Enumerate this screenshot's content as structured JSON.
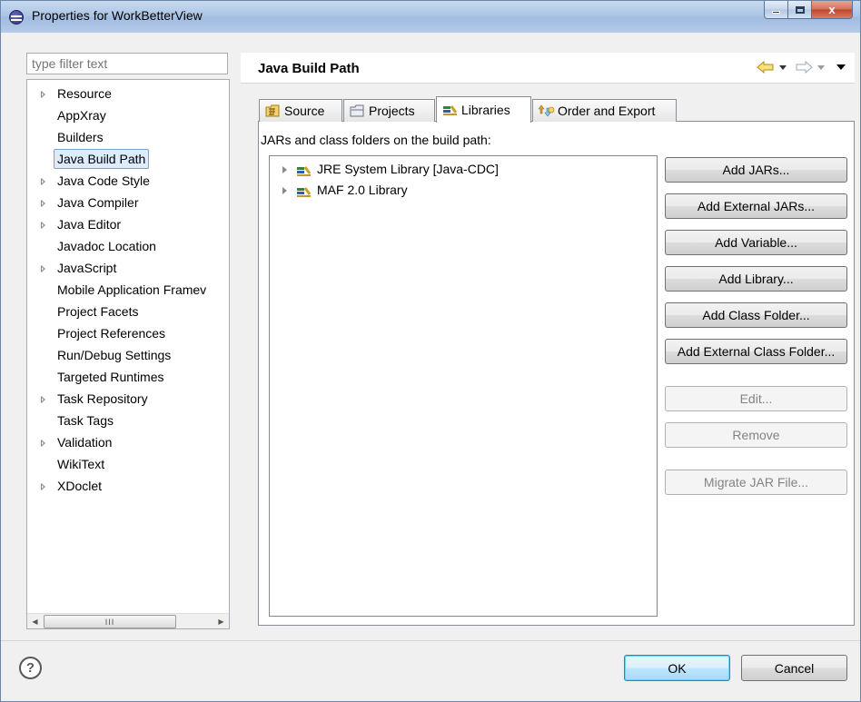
{
  "window": {
    "title": "Properties for WorkBetterView",
    "close_glyph": "x"
  },
  "sidebar": {
    "filter_placeholder": "type filter text",
    "items": [
      {
        "label": "Resource",
        "expandable": true
      },
      {
        "label": "AppXray",
        "expandable": false
      },
      {
        "label": "Builders",
        "expandable": false
      },
      {
        "label": "Java Build Path",
        "expandable": false,
        "selected": true
      },
      {
        "label": "Java Code Style",
        "expandable": true
      },
      {
        "label": "Java Compiler",
        "expandable": true
      },
      {
        "label": "Java Editor",
        "expandable": true
      },
      {
        "label": "Javadoc Location",
        "expandable": false
      },
      {
        "label": "JavaScript",
        "expandable": true
      },
      {
        "label": "Mobile Application Framev",
        "expandable": false
      },
      {
        "label": "Project Facets",
        "expandable": false
      },
      {
        "label": "Project References",
        "expandable": false
      },
      {
        "label": "Run/Debug Settings",
        "expandable": false
      },
      {
        "label": "Targeted Runtimes",
        "expandable": false
      },
      {
        "label": "Task Repository",
        "expandable": true
      },
      {
        "label": "Task Tags",
        "expandable": false
      },
      {
        "label": "Validation",
        "expandable": true
      },
      {
        "label": "WikiText",
        "expandable": false
      },
      {
        "label": "XDoclet",
        "expandable": true
      }
    ],
    "scroll_thumb_glyph": "III"
  },
  "page": {
    "title": "Java Build Path",
    "tabs": [
      {
        "label": "Source",
        "icon": "source-folder-icon"
      },
      {
        "label": "Projects",
        "icon": "project-folder-icon"
      },
      {
        "label": "Libraries",
        "icon": "library-icon",
        "active": true
      },
      {
        "label": "Order and Export",
        "icon": "order-export-icon"
      }
    ],
    "list_label": "JARs and class folders on the build path:",
    "libraries": [
      {
        "label": "JRE System Library [Java-CDC]",
        "icon": "library-icon"
      },
      {
        "label": "MAF 2.0 Library",
        "icon": "library-icon"
      }
    ],
    "buttons": {
      "add_jars": "Add JARs...",
      "add_external_jars": "Add External JARs...",
      "add_variable": "Add Variable...",
      "add_library": "Add Library...",
      "add_class_folder": "Add Class Folder...",
      "add_external_class_folder": "Add External Class Folder...",
      "edit": "Edit...",
      "remove": "Remove",
      "migrate_jar": "Migrate JAR File..."
    }
  },
  "footer": {
    "help_glyph": "?",
    "ok_label": "OK",
    "cancel_label": "Cancel"
  },
  "colors": {
    "selection_bg": "#dcecfc",
    "default_button_border": "#3c7fb1",
    "disabled_text": "#838383"
  }
}
